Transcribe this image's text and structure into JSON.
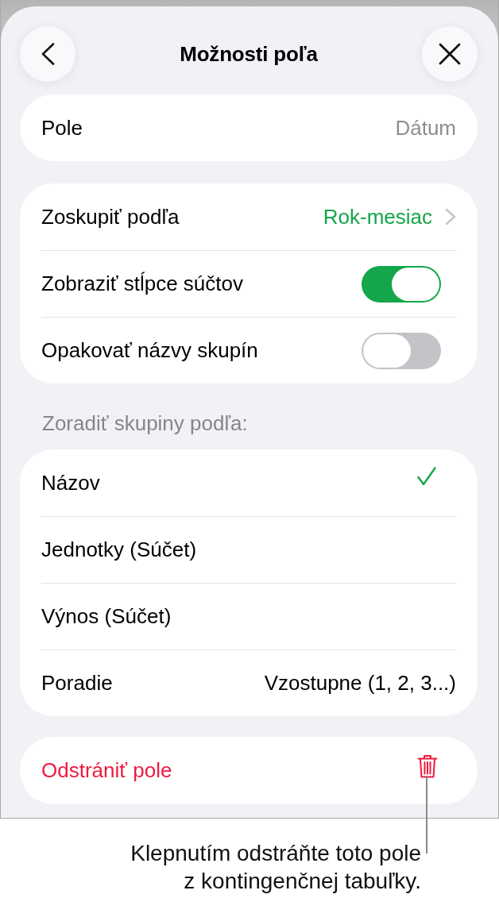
{
  "header": {
    "title": "Možnosti poľa"
  },
  "field": {
    "label": "Pole",
    "value": "Dátum"
  },
  "options": [
    {
      "kind": "link",
      "label": "Zoskupiť podľa",
      "value": "Rok-mesiac"
    },
    {
      "kind": "toggle",
      "label": "Zobraziť stĺpce súčtov",
      "on": true
    },
    {
      "kind": "toggle",
      "label": "Opakovať názvy skupín",
      "on": false
    }
  ],
  "sort": {
    "heading": "Zoradiť skupiny podľa:",
    "items": [
      {
        "label": "Názov",
        "selected": true
      },
      {
        "label": "Jednotky (Súčet)",
        "selected": false
      },
      {
        "label": "Výnos (Súčet)",
        "selected": false
      }
    ],
    "order": {
      "label": "Poradie",
      "value": "Vzostupne (1, 2, 3...)"
    }
  },
  "delete_button": {
    "label": "Odstrániť pole"
  },
  "callout": {
    "text": "Klepnutím odstráňte toto pole\nz kontingenčnej tabuľky."
  }
}
